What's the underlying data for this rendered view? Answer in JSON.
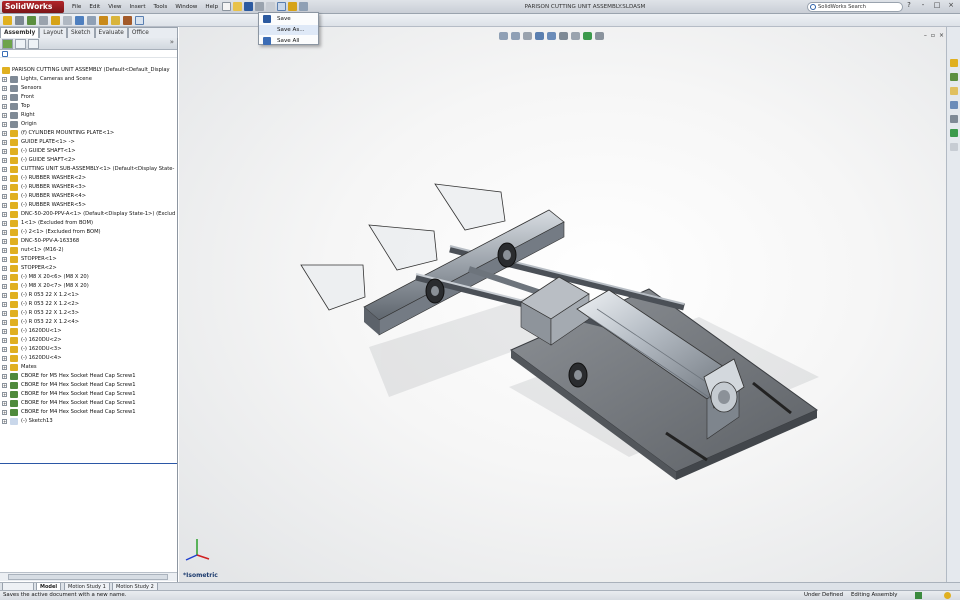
{
  "app": {
    "name": "SolidWorks",
    "document_title": "PARISON CUTTING UNIT ASSEMBLY.SLDASM"
  },
  "menu": [
    "File",
    "Edit",
    "View",
    "Insert",
    "Tools",
    "Window",
    "Help"
  ],
  "search": {
    "placeholder": "SolidWorks Search"
  },
  "window_controls": [
    "?",
    "-",
    "□",
    "×"
  ],
  "command_tabs": [
    "Assembly",
    "Layout",
    "Sketch",
    "Evaluate",
    "Office Products"
  ],
  "save_menu": {
    "items": [
      "Save",
      "Save As...",
      "Save All"
    ],
    "highlighted": "Save As..."
  },
  "tree": {
    "root": "PARISON CUTTING UNIT ASSEMBLY  (Default<Default_Display",
    "nodes": [
      "Lights, Cameras and Scene",
      "Sensors",
      "Front",
      "Top",
      "Right",
      "Origin",
      "(f) CYLINDER MOUNTING PLATE<1>",
      "GUIDE PLATE<1> ->",
      "(-) GUIDE SHAFT<1>",
      "(-) GUIDE SHAFT<2>",
      "CUTTING UNIT SUB-ASSEMBLY<1> (Default<Display State-",
      "(-) RUBBER WASHER<2>",
      "(-) RUBBER WASHER<3>",
      "(-) RUBBER WASHER<4>",
      "(-) RUBBER WASHER<5>",
      "DNC-50-200-PPV-A<1> (Default<Display State-1>) (Exclud",
      "1<1> (Excluded from BOM)",
      "(-) 2<1> (Excluded from BOM)",
      "DNC-50-PPV-A-163368",
      "nut<1> (M16-2)",
      "STOPPER<1>",
      "STOPPER<2>",
      "(-) M8 X 20<6> (M8 X 20)",
      "(-) M8 X 20<7> (M8 X 20)",
      "(-) R 053 22 X 1.2<1>",
      "(-) R 053 22 X 1.2<2>",
      "(-) R 053 22 X 1.2<3>",
      "(-) R 053 22 X 1.2<4>",
      "(-) 1620DU<1>",
      "(-) 1620DU<2>",
      "(-) 1620DU<3>",
      "(-) 1620DU<4>",
      "Mates",
      "CBORE for M5 Hex Socket Head Cap Screw1",
      "CBORE for M4 Hex Socket Head Cap Screw1",
      "CBORE for M4 Hex Socket Head Cap Screw1",
      "CBORE for M4 Hex Socket Head Cap Screw1",
      "CBORE for M4 Hex Socket Head Cap Screw1",
      "(-) Sketch13"
    ]
  },
  "view": {
    "orientation": "*Isometric"
  },
  "bottom_tabs": [
    "Model",
    "Motion Study 1",
    "Motion Study 2"
  ],
  "status": {
    "message": "Saves the active document with a new name.",
    "definition": "Under Defined",
    "mode": "Editing Assembly"
  },
  "colors": {
    "accent": "#2c5aa0",
    "logo_red": "#b3262a",
    "tree_icon_yellow": "#e0b020",
    "tree_icon_gray": "#7f8a96"
  }
}
